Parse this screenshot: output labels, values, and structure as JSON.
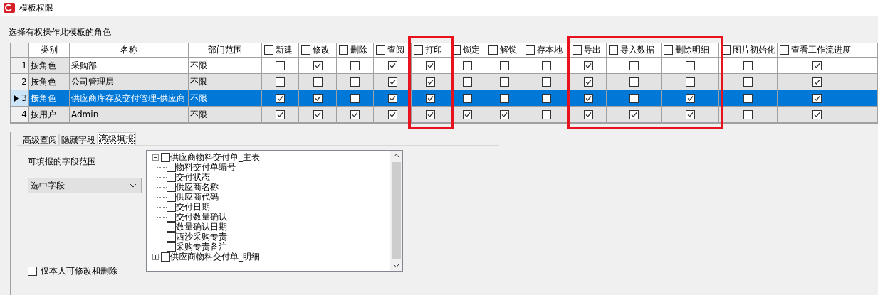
{
  "window": {
    "title": "模板权限"
  },
  "roles_label": "选择有权操作此模板的角色",
  "table": {
    "columns": [
      {
        "label": "类别"
      },
      {
        "label": "名称"
      },
      {
        "label": "部门范围"
      }
    ],
    "permission_columns": [
      {
        "label": "新建",
        "checked": false,
        "highlighted": false
      },
      {
        "label": "修改",
        "checked": false,
        "highlighted": false
      },
      {
        "label": "删除",
        "checked": false,
        "highlighted": false
      },
      {
        "label": "查阅",
        "checked": false,
        "highlighted": false
      },
      {
        "label": "打印",
        "checked": false,
        "highlighted": true
      },
      {
        "label": "锁定",
        "checked": false,
        "highlighted": false
      },
      {
        "label": "解锁",
        "checked": false,
        "highlighted": false
      },
      {
        "label": "存本地",
        "checked": false,
        "highlighted": false
      },
      {
        "label": "导出",
        "checked": false,
        "highlighted": true
      },
      {
        "label": "导入数据",
        "checked": false,
        "highlighted": true
      },
      {
        "label": "删除明细",
        "checked": false,
        "highlighted": true
      },
      {
        "label": "图片初始化",
        "checked": false,
        "highlighted": false
      },
      {
        "label": "查看工作流进度",
        "checked": false,
        "highlighted": false
      }
    ],
    "rows": [
      {
        "number": "1",
        "category": "按角色",
        "name": "采购部",
        "scope": "不限",
        "selected": false,
        "permissions": [
          {
            "checked": false
          },
          {
            "checked": true
          },
          {
            "checked": false
          },
          {
            "checked": true
          },
          {
            "checked": true
          },
          {
            "checked": false
          },
          {
            "checked": false
          },
          {
            "checked": false
          },
          {
            "checked": true
          },
          {
            "checked": false
          },
          {
            "checked": false
          },
          {
            "checked": false
          },
          {
            "checked": true
          }
        ]
      },
      {
        "number": "2",
        "category": "按角色",
        "name": "公司管理层",
        "scope": "不限",
        "selected": false,
        "permissions": [
          {
            "checked": false
          },
          {
            "checked": false
          },
          {
            "checked": false
          },
          {
            "checked": true
          },
          {
            "checked": true
          },
          {
            "checked": false
          },
          {
            "checked": false
          },
          {
            "checked": false
          },
          {
            "checked": true
          },
          {
            "checked": false
          },
          {
            "checked": false
          },
          {
            "checked": false
          },
          {
            "checked": true
          }
        ]
      },
      {
        "number": "3",
        "category": "按角色",
        "name": "供应商库存及交付管理-供应商",
        "scope": "不限",
        "selected": true,
        "permissions": [
          {
            "checked": true
          },
          {
            "checked": true
          },
          {
            "checked": false
          },
          {
            "checked": true
          },
          {
            "checked": true
          },
          {
            "checked": false
          },
          {
            "checked": false
          },
          {
            "checked": false
          },
          {
            "checked": true
          },
          {
            "checked": false
          },
          {
            "checked": true
          },
          {
            "checked": false
          },
          {
            "checked": true
          }
        ]
      },
      {
        "number": "4",
        "category": "按用户",
        "name": "Admin",
        "scope": "不限",
        "selected": false,
        "permissions": [
          {
            "checked": true
          },
          {
            "checked": true
          },
          {
            "checked": true
          },
          {
            "checked": true
          },
          {
            "checked": true
          },
          {
            "checked": true
          },
          {
            "checked": true
          },
          {
            "checked": false
          },
          {
            "checked": true
          },
          {
            "checked": true
          },
          {
            "checked": true
          },
          {
            "checked": false
          },
          {
            "checked": true
          }
        ]
      }
    ]
  },
  "tabs": [
    {
      "label": "高级查阅",
      "selected": false
    },
    {
      "label": "隐藏字段",
      "selected": false
    },
    {
      "label": "高级填报",
      "selected": true
    }
  ],
  "fill_panel": {
    "scope_label": "可填报的字段范围",
    "scope_dropdown": {
      "value": "选中字段"
    },
    "own_only": {
      "label": "仅本人可修改和删除",
      "checked": false
    },
    "tree": [
      {
        "label": "供应商物料交付单_主表",
        "checked": false,
        "expanded": true,
        "children": [
          {
            "label": "物料交付单编号",
            "checked": false
          },
          {
            "label": "交付状态",
            "checked": false
          },
          {
            "label": "供应商名称",
            "checked": false
          },
          {
            "label": "供应商代码",
            "checked": false
          },
          {
            "label": "交付日期",
            "checked": false
          },
          {
            "label": "交付数量确认",
            "checked": false
          },
          {
            "label": "数量确认日期",
            "checked": false
          },
          {
            "label": "西沙采购专责",
            "checked": false
          },
          {
            "label": "采购专责备注",
            "checked": false
          }
        ]
      },
      {
        "label": "供应商物料交付单_明细",
        "checked": false,
        "expanded": false
      }
    ]
  }
}
